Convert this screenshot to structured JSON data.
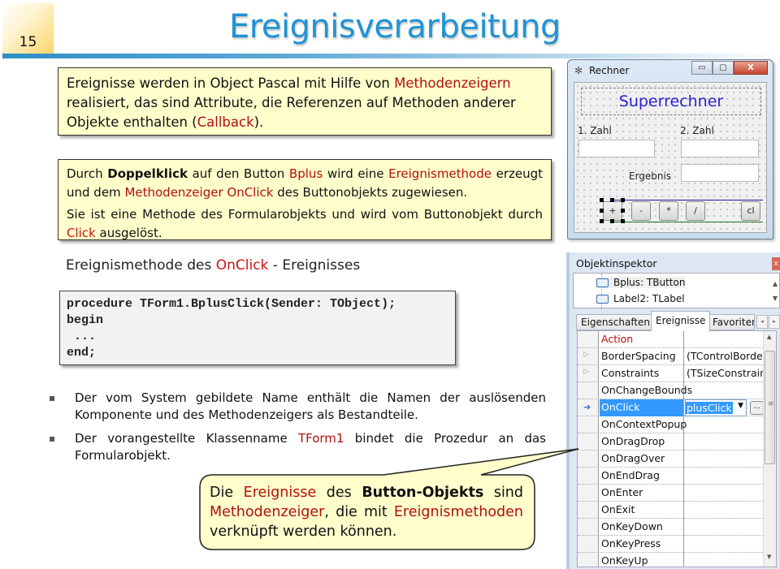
{
  "header": {
    "page_number": "15",
    "title": "Ereignisverarbeitung"
  },
  "box1": {
    "t1": "Ereignisse werden in Object Pascal mit Hilfe von ",
    "h1": "Methodenzeigern",
    "t2": " realisiert, das sind Attribute, die Referenzen auf Methoden anderer Objekte enthalten (",
    "h2": "Callback",
    "t3": ")."
  },
  "box2": {
    "p1": {
      "t1": "Durch ",
      "b1": "Doppelklick",
      "t2": " auf den Button ",
      "h1": "Bplus",
      "t3": " wird eine ",
      "h2": "Ereignismethode",
      "t4": " erzeugt und dem ",
      "h3": "Methodenzeiger OnClick",
      "t5": " des Buttonobjekts zugewiesen."
    },
    "p2": {
      "t1": "Sie ist eine Methode des Formularobjekts und wird vom Buttonobjekt durch ",
      "h1": "Click",
      "t2": " ausgelöst."
    }
  },
  "subhead": {
    "t1": "Ereignismethode des ",
    "h1": "OnClick",
    "t2": " - Ereignisses"
  },
  "code": "procedure TForm1.BplusClick(Sender: TObject);\nbegin\n ...\nend;",
  "bullets": [
    {
      "t1": "Der vom System gebildete Name enthält die Namen der auslösenden Komponente und des Methodenzeigers als Bestandteile."
    },
    {
      "t1": "Der vorangestellte Klassenname ",
      "h1": "TForm1",
      "t2": " bindet die Prozedur an das Formularobjekt."
    }
  ],
  "bullet_glyph": "▪",
  "callout": {
    "t1": "Die ",
    "h1": "Ereignisse",
    "t2": " des ",
    "b1": "Button-Objekts",
    "t3": " sind ",
    "h2": "Methodenzeiger",
    "t4": ", die mit ",
    "h3": "Ereignismethoden",
    "t5": " verknüpft werden können."
  },
  "rechner": {
    "title": "Rechner",
    "app_icon": "✻",
    "minimize": "▭",
    "maximize": "▢",
    "close": "X",
    "heading_label": "Superrechner",
    "label_zahl1": "1. Zahl",
    "label_zahl2": "2. Zahl",
    "label_ergebnis": "Ergebnis",
    "buttons": [
      "+",
      "-",
      "*",
      "/",
      "cl"
    ]
  },
  "inspector": {
    "title": "Objektinspektor",
    "close": "x",
    "tree": [
      {
        "label": "Bplus: TButton",
        "selected": true
      },
      {
        "label": "Label2: TLabel",
        "selected": false
      }
    ],
    "tabs": [
      "Eigenschaften",
      "Ereignisse",
      "Favoriten"
    ],
    "active_tab": "Ereignisse",
    "rows": [
      {
        "name": "Action",
        "value": "",
        "icon": "",
        "highlight": true
      },
      {
        "name": "BorderSpacing",
        "value": "(TControlBorderS",
        "icon": "▷"
      },
      {
        "name": "Constraints",
        "value": "(TSizeConstraints",
        "icon": "▷"
      },
      {
        "name": "OnChangeBounds",
        "value": "",
        "icon": ""
      },
      {
        "name": "OnClick",
        "value": "plusClick",
        "icon": "➔",
        "selected": true
      },
      {
        "name": "OnContextPopup",
        "value": "",
        "icon": ""
      },
      {
        "name": "OnDragDrop",
        "value": "",
        "icon": ""
      },
      {
        "name": "OnDragOver",
        "value": "",
        "icon": ""
      },
      {
        "name": "OnEndDrag",
        "value": "",
        "icon": ""
      },
      {
        "name": "OnEnter",
        "value": "",
        "icon": ""
      },
      {
        "name": "OnExit",
        "value": "",
        "icon": ""
      },
      {
        "name": "OnKeyDown",
        "value": "",
        "icon": ""
      },
      {
        "name": "OnKeyPress",
        "value": "",
        "icon": ""
      },
      {
        "name": "OnKeyUp",
        "value": "",
        "icon": ""
      }
    ],
    "combo_arrow": "▼",
    "ellipsis": "...",
    "scroll_up": "▲",
    "scroll_down": "▼",
    "tab_left": "◂",
    "tab_right": "▸",
    "grip": "≡"
  },
  "colors": {
    "title": "#1f93d3",
    "highlight": "#b30f0f",
    "box_bg": "#ffffcc",
    "selection": "#3399ff",
    "superrechner": "#2a1fd1"
  }
}
